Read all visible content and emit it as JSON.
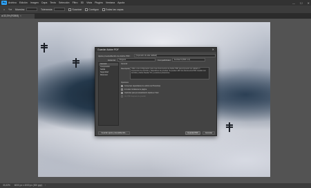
{
  "app": {
    "logo": "Ps"
  },
  "menubar": {
    "items": [
      "Archivo",
      "Edición",
      "Imagen",
      "Capa",
      "Texto",
      "Selección",
      "Filtro",
      "3D",
      "Vista",
      "Plugins",
      "Ventana",
      "Ayuda"
    ],
    "window_controls": [
      "—",
      "☐",
      "✕"
    ]
  },
  "options_bar": {
    "items": [
      "Muestra:",
      "Tolerancia:",
      "Suavizar",
      "Contiguo",
      "Todas las capas"
    ]
  },
  "tab": {
    "label": "al 33,3% (RGB/8)",
    "close": "×"
  },
  "statusbar": {
    "zoom": "33,33%",
    "info": "6000 px x 4000 px (300 ppp)",
    "arrow": "›"
  },
  "dialog": {
    "title": "Guardar Adobe PDF",
    "close": "✕",
    "preset_label": "Ajuste preestablecido de Adobe PDF:",
    "preset_value": "[Impresión de alta calidad]",
    "standard_label": "Estándar:",
    "standard_value": "Ninguno",
    "compat_label": "Compatibilidad:",
    "compat_value": "Acrobat 5 (PDF 1.4)",
    "sidebar": [
      "General",
      "Compresión",
      "Salida",
      "Seguridad",
      "Resumen"
    ],
    "panel_title": "General",
    "description_label": "Descripción:",
    "description_text": "Utilice esta configuración para crear documentos de Adobe PDF para impresión de calidad en impresoras de escritorio y dispositivos de pruebas. Se pueden abrir los documentos PDF creados con Acrobat y Adobe Reader 5.0 y versiones posteriores.",
    "options_label": "Opciones",
    "options": [
      {
        "label": "Conservar capacidades de edición de Photoshop",
        "checked": true,
        "disabled": false
      },
      {
        "label": "Incrustar miniaturas de página",
        "checked": false,
        "disabled": false
      },
      {
        "label": "Optimizar para previsualización rápida en Web",
        "checked": true,
        "disabled": false
      },
      {
        "label": "Ver PDF después de guardar",
        "checked": false,
        "disabled": true
      }
    ],
    "save_preset_button": "Guardar ajuste preestablecido...",
    "save_button": "Guardar PDF",
    "cancel_button": "Cancelar"
  }
}
